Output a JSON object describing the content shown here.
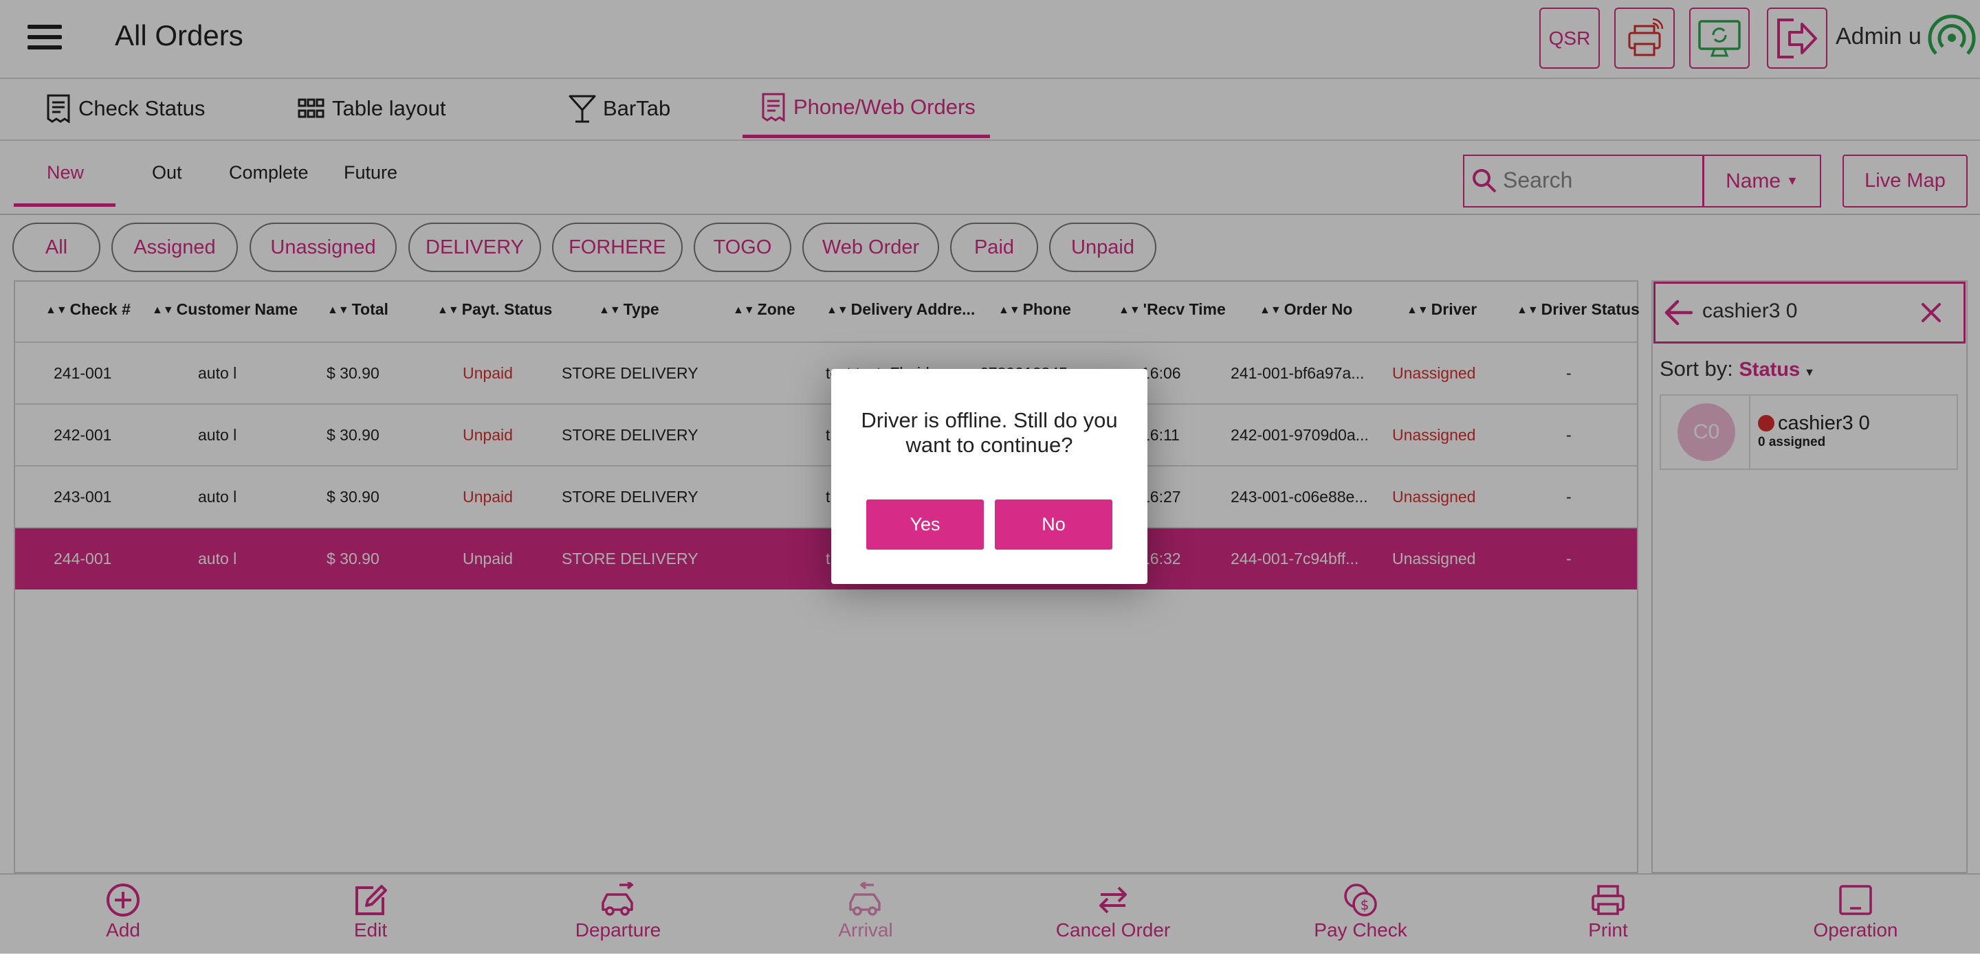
{
  "header": {
    "title": "All Orders",
    "qsr_label": "QSR",
    "user": "Admin u"
  },
  "tabs": [
    {
      "label": "Check Status",
      "icon": "receipt-icon"
    },
    {
      "label": "Table layout",
      "icon": "grid-icon"
    },
    {
      "label": "BarTab",
      "icon": "cocktail-icon"
    },
    {
      "label": "Phone/Web Orders",
      "icon": "receipt-icon",
      "active": true
    }
  ],
  "subtabs": [
    "New",
    "Out",
    "Complete",
    "Future"
  ],
  "search": {
    "placeholder": "Search",
    "filter_label": "Name",
    "live_map_label": "Live Map"
  },
  "filters": [
    "All",
    "Assigned",
    "Unassigned",
    "DELIVERY",
    "FORHERE",
    "TOGO",
    "Web Order",
    "Paid",
    "Unpaid"
  ],
  "table": {
    "columns": [
      "Check #",
      "Customer Name",
      "Total",
      "Payt. Status",
      "Type",
      "Zone",
      "Delivery Addre...",
      "Phone",
      "'Recv Time",
      "Order No",
      "Driver",
      "Driver Status"
    ],
    "rows": [
      {
        "check": "241-001",
        "customer": "auto l",
        "total": "$ 30.90",
        "payt": "Unpaid",
        "type": "STORE DELIVERY",
        "zone": "",
        "address": "test test, Florida",
        "phone": "6789012345",
        "recv": "16:06",
        "order_no": "241-001-bf6a97a...",
        "driver": "Unassigned",
        "driver_status": "-"
      },
      {
        "check": "242-001",
        "customer": "auto l",
        "total": "$ 30.90",
        "payt": "Unpaid",
        "type": "STORE DELIVERY",
        "zone": "",
        "address": "t",
        "phone": "",
        "recv": "16:11",
        "order_no": "242-001-9709d0a...",
        "driver": "Unassigned",
        "driver_status": "-"
      },
      {
        "check": "243-001",
        "customer": "auto l",
        "total": "$ 30.90",
        "payt": "Unpaid",
        "type": "STORE DELIVERY",
        "zone": "",
        "address": "t",
        "phone": "",
        "recv": "16:27",
        "order_no": "243-001-c06e88e...",
        "driver": "Unassigned",
        "driver_status": "-"
      },
      {
        "check": "244-001",
        "customer": "auto l",
        "total": "$ 30.90",
        "payt": "Unpaid",
        "type": "STORE DELIVERY",
        "zone": "",
        "address": "t",
        "phone": "",
        "recv": "16:32",
        "order_no": "244-001-7c94bff...",
        "driver": "Unassigned",
        "driver_status": "-"
      }
    ]
  },
  "driver_panel": {
    "search_value": "cashier3 0",
    "sort_label": "Sort by:",
    "sort_value": "Status",
    "drivers": [
      {
        "initials": "C0",
        "name": "cashier3 0",
        "assigned": "0 assigned",
        "status_color": "#d9302f"
      }
    ]
  },
  "bottom_actions": [
    {
      "label": "Add",
      "icon": "plus-circle-icon"
    },
    {
      "label": "Edit",
      "icon": "edit-icon"
    },
    {
      "label": "Departure",
      "icon": "departure-car-icon"
    },
    {
      "label": "Arrival",
      "icon": "arrival-car-icon",
      "disabled": true
    },
    {
      "label": "Cancel Order",
      "icon": "swap-icon"
    },
    {
      "label": "Pay Check",
      "icon": "pay-check-icon"
    },
    {
      "label": "Print",
      "icon": "printer-icon"
    },
    {
      "label": "Operation",
      "icon": "operation-icon"
    }
  ],
  "dialog": {
    "message": "Driver is offline. Still do you want to continue?",
    "yes": "Yes",
    "no": "No"
  },
  "colors": {
    "accent": "#d62b86",
    "offline": "#d9302f",
    "online": "#2fa84f"
  }
}
